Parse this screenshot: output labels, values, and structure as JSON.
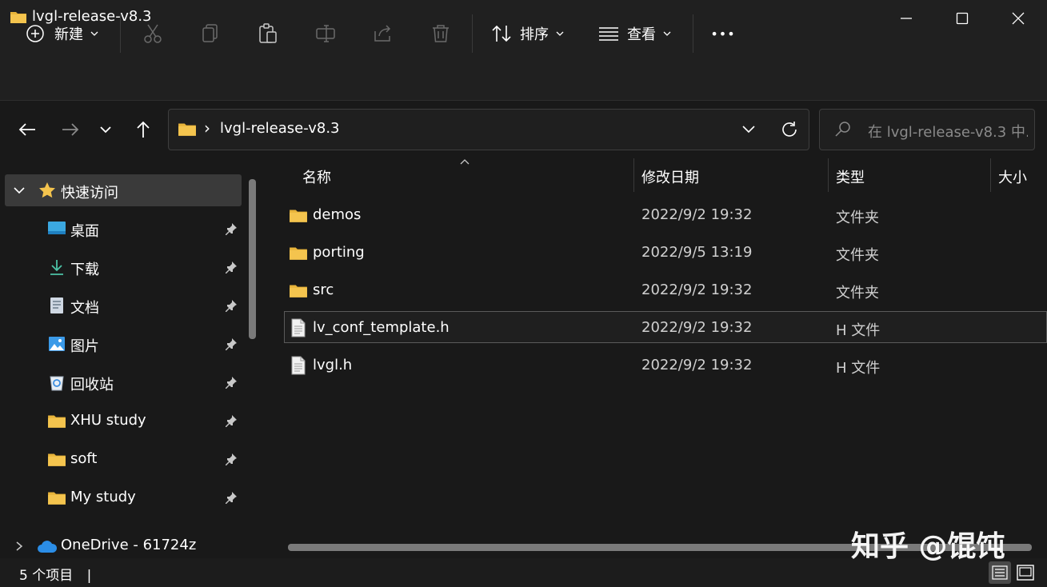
{
  "window": {
    "title": "lvgl-release-v8.3"
  },
  "commandbar": {
    "new_label": "新建",
    "sort_label": "排序",
    "view_label": "查看",
    "more_label": "•••"
  },
  "navigation": {
    "breadcrumb_sep": "›",
    "path": "lvgl-release-v8.3",
    "search_placeholder": "在 lvgl-release-v8.3 中..."
  },
  "sidebar": {
    "quick_access_label": "快速访问",
    "items": [
      {
        "label": "桌面",
        "icon": "desktop-icon",
        "pinned": true
      },
      {
        "label": "下载",
        "icon": "download-icon",
        "pinned": true
      },
      {
        "label": "文档",
        "icon": "document-icon",
        "pinned": true
      },
      {
        "label": "图片",
        "icon": "pictures-icon",
        "pinned": true
      },
      {
        "label": "回收站",
        "icon": "recycle-bin-icon",
        "pinned": true
      },
      {
        "label": "XHU study",
        "icon": "folder-icon",
        "pinned": true
      },
      {
        "label": "soft",
        "icon": "folder-icon",
        "pinned": true
      },
      {
        "label": "My study",
        "icon": "folder-icon",
        "pinned": true
      }
    ],
    "onedrive_label": "OneDrive - 61724z"
  },
  "file_list": {
    "columns": [
      "名称",
      "修改日期",
      "类型",
      "大小"
    ],
    "rows": [
      {
        "name": "demos",
        "modified": "2022/9/2 19:32",
        "type": "文件夹",
        "kind": "folder"
      },
      {
        "name": "porting",
        "modified": "2022/9/5 13:19",
        "type": "文件夹",
        "kind": "folder"
      },
      {
        "name": "src",
        "modified": "2022/9/2 19:32",
        "type": "文件夹",
        "kind": "folder"
      },
      {
        "name": "lv_conf_template.h",
        "modified": "2022/9/2 19:32",
        "type": "H 文件",
        "kind": "file",
        "selected": true
      },
      {
        "name": "lvgl.h",
        "modified": "2022/9/2 19:32",
        "type": "H 文件",
        "kind": "file"
      }
    ]
  },
  "statusbar": {
    "item_count": "5 个项目",
    "cursor": "|"
  },
  "watermark": "知乎 @馄饨",
  "colors": {
    "background": "#191919",
    "titlebar": "#202020",
    "folder": "#f4c44e",
    "selection": "#3a3a3a"
  }
}
